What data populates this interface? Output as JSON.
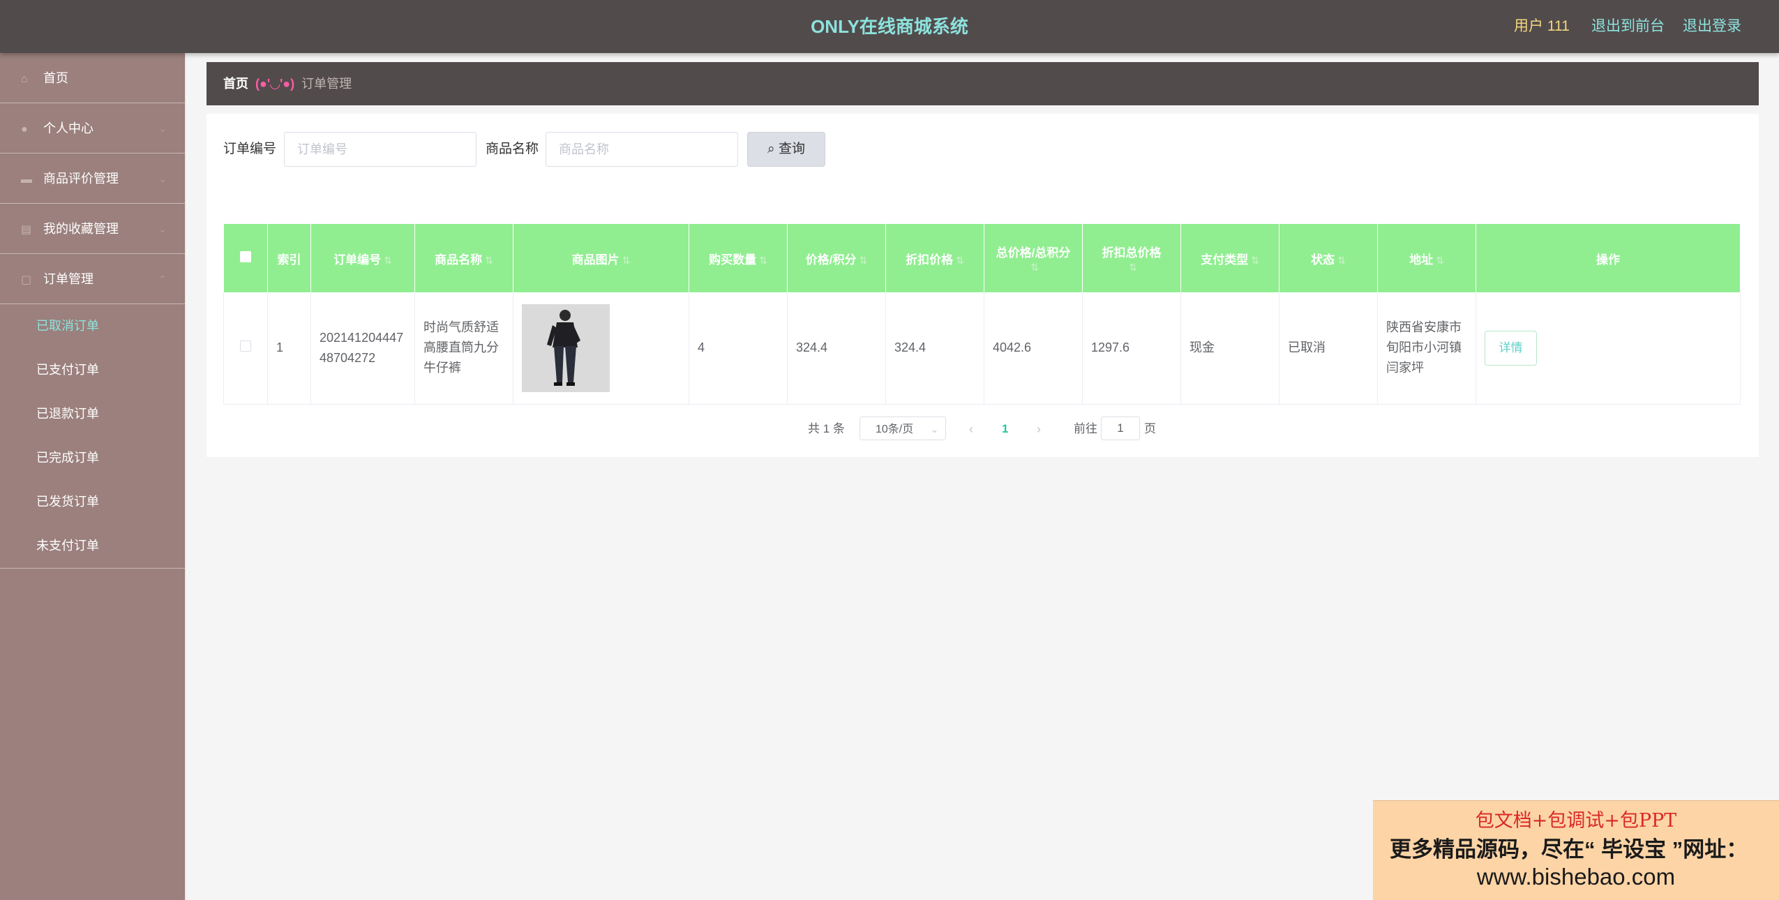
{
  "header": {
    "title": "ONLY在线商城系统",
    "user_label": "用户 111",
    "front_link": "退出到前台",
    "logout_link": "退出登录"
  },
  "sidebar": {
    "items": [
      {
        "label": "首页",
        "icon": "home-icon"
      },
      {
        "label": "个人中心",
        "icon": "user-icon"
      },
      {
        "label": "商品评价管理",
        "icon": "comment-icon"
      },
      {
        "label": "我的收藏管理",
        "icon": "star-icon"
      },
      {
        "label": "订单管理",
        "icon": "order-icon"
      }
    ],
    "order_submenu": [
      {
        "label": "已取消订单",
        "active": true
      },
      {
        "label": "已支付订单"
      },
      {
        "label": "已退款订单"
      },
      {
        "label": "已完成订单"
      },
      {
        "label": "已发货订单"
      },
      {
        "label": "未支付订单"
      }
    ]
  },
  "breadcrumb": {
    "home": "首页",
    "emote": "(●'◡'●)",
    "current": "订单管理"
  },
  "search": {
    "order_no_label": "订单编号",
    "order_no_placeholder": "订单编号",
    "product_name_label": "商品名称",
    "product_name_placeholder": "商品名称",
    "query_button": "查询"
  },
  "table": {
    "columns": [
      "索引",
      "订单编号",
      "商品名称",
      "商品图片",
      "购买数量",
      "价格/积分",
      "折扣价格",
      "总价格/总积分",
      "折扣总价格",
      "支付类型",
      "状态",
      "地址",
      "操作"
    ],
    "rows": [
      {
        "index": "1",
        "order_no": "20214120444748704272",
        "product_name": "时尚气质舒适高腰直筒九分牛仔裤",
        "quantity": "4",
        "price": "324.4",
        "discount_price": "324.4",
        "total_price": "4042.6",
        "discount_total": "1297.6",
        "pay_type": "现金",
        "status": "已取消",
        "address": "陕西省安康市旬阳市小河镇闫家坪",
        "action": "详情"
      }
    ]
  },
  "pagination": {
    "total_text": "共 1 条",
    "page_size": "10条/页",
    "current_page": "1",
    "goto_label": "前往",
    "goto_value": "1",
    "page_suffix": "页"
  },
  "ad": {
    "line1": "包文档+包调试+包PPT",
    "line2": "更多精品源码，尽在“ 毕设宝 ”网址：",
    "line3": "www.bishebao.com"
  },
  "colors": {
    "header_bg": "#524b4c",
    "sidebar_bg": "#9b807d",
    "accent_teal": "#8de3dd",
    "table_head": "#90ee90",
    "user_yellow": "#f3d77d"
  }
}
